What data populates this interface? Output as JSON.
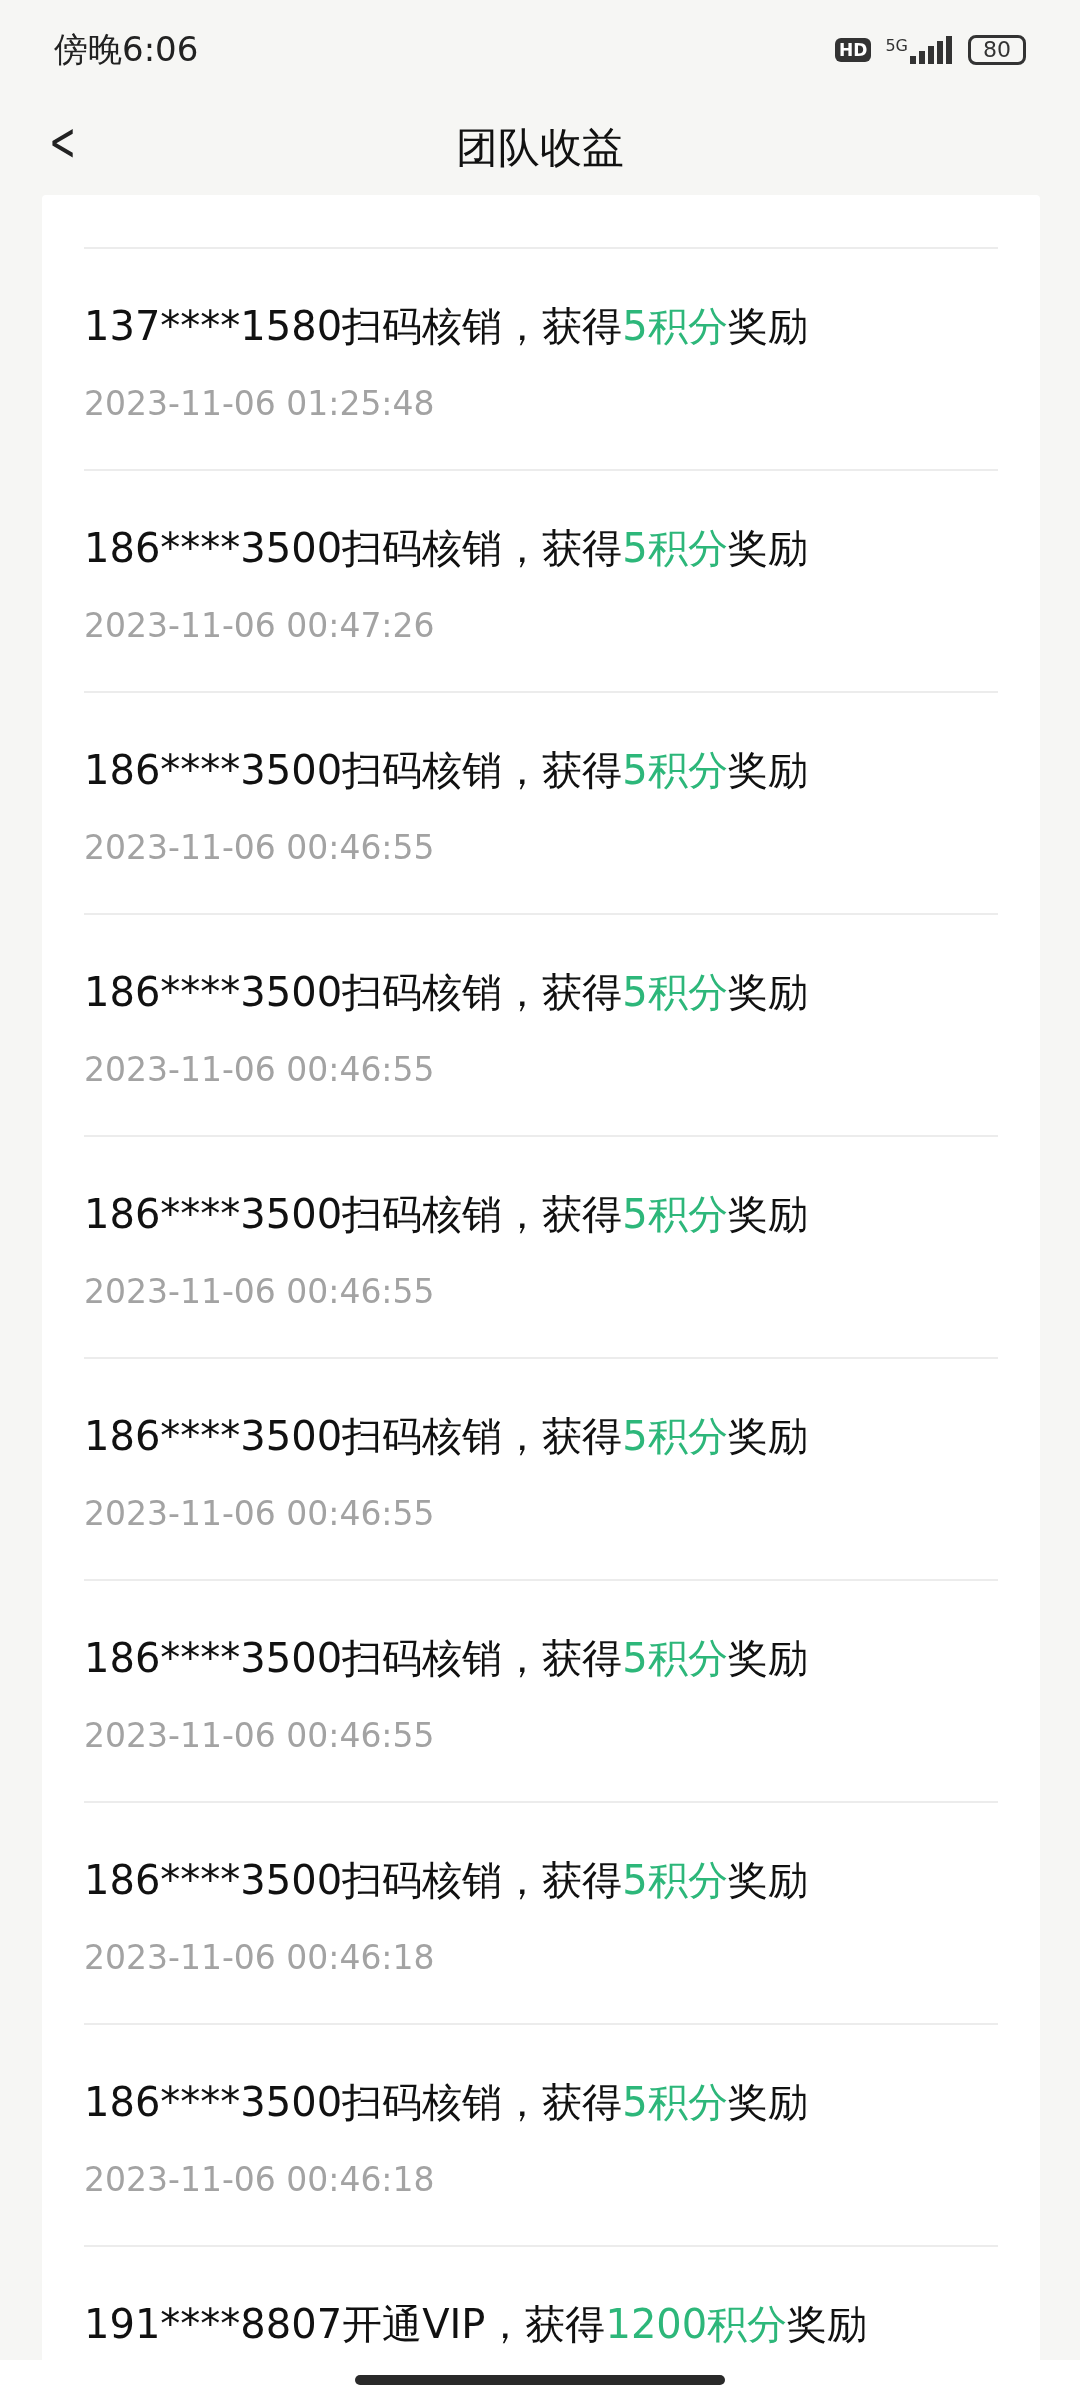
{
  "status_bar": {
    "time": "傍晚6:06",
    "hd": "HD",
    "network": "5G",
    "battery": "80"
  },
  "header": {
    "back": "<",
    "title": "团队收益"
  },
  "records": [
    {
      "prefix": "137****1580扫码核销，获得",
      "reward": "5积分",
      "suffix": "奖励",
      "time": "2023-11-06 01:25:48"
    },
    {
      "prefix": "186****3500扫码核销，获得",
      "reward": "5积分",
      "suffix": "奖励",
      "time": "2023-11-06 00:47:26"
    },
    {
      "prefix": "186****3500扫码核销，获得",
      "reward": "5积分",
      "suffix": "奖励",
      "time": "2023-11-06 00:46:55"
    },
    {
      "prefix": "186****3500扫码核销，获得",
      "reward": "5积分",
      "suffix": "奖励",
      "time": "2023-11-06 00:46:55"
    },
    {
      "prefix": "186****3500扫码核销，获得",
      "reward": "5积分",
      "suffix": "奖励",
      "time": "2023-11-06 00:46:55"
    },
    {
      "prefix": "186****3500扫码核销，获得",
      "reward": "5积分",
      "suffix": "奖励",
      "time": "2023-11-06 00:46:55"
    },
    {
      "prefix": "186****3500扫码核销，获得",
      "reward": "5积分",
      "suffix": "奖励",
      "time": "2023-11-06 00:46:55"
    },
    {
      "prefix": "186****3500扫码核销，获得",
      "reward": "5积分",
      "suffix": "奖励",
      "time": "2023-11-06 00:46:18"
    },
    {
      "prefix": "186****3500扫码核销，获得",
      "reward": "5积分",
      "suffix": "奖励",
      "time": "2023-11-06 00:46:18"
    },
    {
      "prefix": "191****8807开通VIP，获得",
      "reward": "1200积分",
      "suffix": "奖励"
    }
  ]
}
